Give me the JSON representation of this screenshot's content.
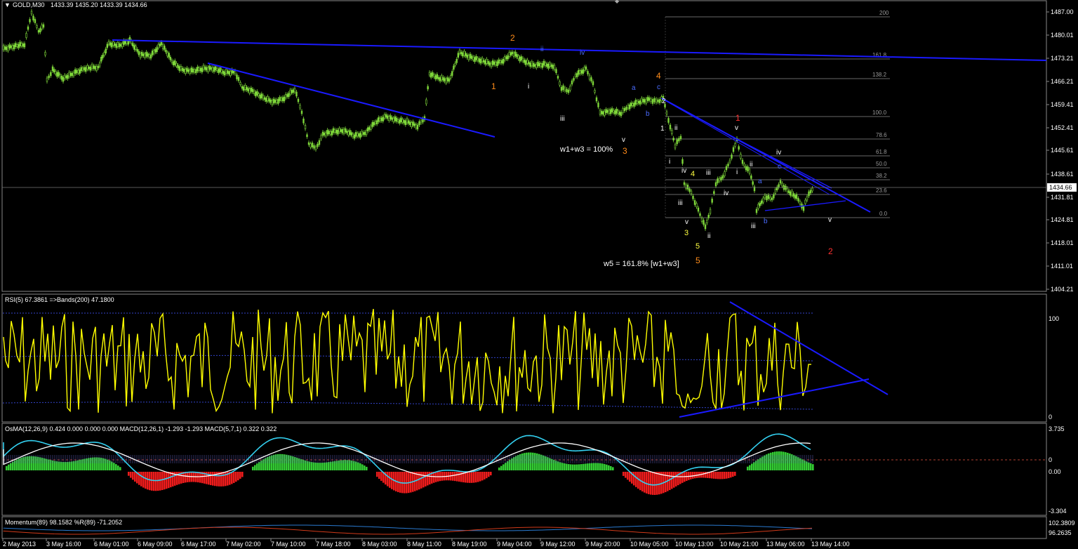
{
  "window": {
    "title": "GOLD,M30",
    "ohlc": "1433.39 1435.20 1433.39 1434.66"
  },
  "main_chart": {
    "price_axis": [
      "1487.00",
      "1480.01",
      "1473.21",
      "1466.21",
      "1459.41",
      "1452.41",
      "1445.61",
      "1438.61",
      "1431.81",
      "1424.81",
      "1418.01",
      "1411.01",
      "1404.21"
    ],
    "current_price": "1434.66",
    "fibs": [
      {
        "label": "200",
        "level": 0
      },
      {
        "label": "161.8",
        "level": 1
      },
      {
        "label": "138.2",
        "level": 2
      },
      {
        "label": "100.0",
        "level": 3
      },
      {
        "label": "78.6",
        "level": 4
      },
      {
        "label": "61.8",
        "level": 5
      },
      {
        "label": "50.0",
        "level": 6
      },
      {
        "label": "38.2",
        "level": 7
      },
      {
        "label": "23.6",
        "level": 8
      },
      {
        "label": "0.0",
        "level": 9
      }
    ],
    "wave_labels": [
      {
        "text": "2",
        "color": "#ff8c1a"
      },
      {
        "text": "1",
        "color": "#ff8c1a"
      },
      {
        "text": "4",
        "color": "#ff8c1a"
      },
      {
        "text": "3",
        "color": "#ff8c1a"
      },
      {
        "text": "5",
        "color": "#ff8c1a"
      },
      {
        "text": "1",
        "color": "#ff3030"
      },
      {
        "text": "2",
        "color": "#ff3030"
      },
      {
        "text": "ii",
        "color": "#4a6cff"
      },
      {
        "text": "iv",
        "color": "#4a6cff"
      },
      {
        "text": "i",
        "color": "#ffffff"
      },
      {
        "text": "iii",
        "color": "#ffffff"
      },
      {
        "text": "v",
        "color": "#ffffff"
      },
      {
        "text": "a",
        "color": "#4a6cff"
      },
      {
        "text": "b",
        "color": "#4a6cff"
      },
      {
        "text": "c",
        "color": "#4a6cff"
      },
      {
        "text": "2",
        "color": "#ffffff"
      },
      {
        "text": "1",
        "color": "#ffffff"
      },
      {
        "text": "ii",
        "color": "#ffffff"
      },
      {
        "text": "i",
        "color": "#ffffff"
      },
      {
        "text": "iv",
        "color": "#ffffff"
      },
      {
        "text": "4",
        "color": "#ffff40"
      },
      {
        "text": "iii",
        "color": "#ffffff"
      },
      {
        "text": "v",
        "color": "#ffffff"
      },
      {
        "text": "3",
        "color": "#ffff40"
      },
      {
        "text": "5",
        "color": "#ffff40"
      },
      {
        "text": "ii",
        "color": "#ffffff"
      },
      {
        "text": "iii",
        "color": "#ffffff"
      },
      {
        "text": "iv",
        "color": "#ffffff"
      },
      {
        "text": "v",
        "color": "#ffffff"
      },
      {
        "text": "i",
        "color": "#ffffff"
      },
      {
        "text": "ii",
        "color": "#ffffff"
      },
      {
        "text": "iv",
        "color": "#ffffff"
      },
      {
        "text": "a",
        "color": "#4a6cff"
      },
      {
        "text": "c",
        "color": "#4a6cff"
      },
      {
        "text": "b",
        "color": "#4a6cff"
      },
      {
        "text": "iii",
        "color": "#ffffff"
      },
      {
        "text": "v",
        "color": "#ffffff"
      }
    ],
    "annotations": {
      "w1w3": "w1+w3 = 100%",
      "w5": "w5 = 161.8% [w1+w3]"
    }
  },
  "rsi": {
    "label": "RSI(5) 67.3861  =>Bands(200) 47.1800",
    "axis_top": "100",
    "axis_bottom": "0"
  },
  "osma": {
    "label": "OsMA(12,26,9) 0.424 0.000 0.000 0.000  MACD(12,26,1) -1.293 -1.293  MACD(5,7,1) 0.322 0.322",
    "axis": [
      "3.735",
      "0",
      "0.00",
      "-3.304"
    ]
  },
  "momentum": {
    "label": "Momentum(89) 98.1582  %R(89) -71.2052",
    "axis": [
      "102.3809",
      "96.2635"
    ]
  },
  "time_axis": [
    "2 May 2013",
    "3 May 16:00",
    "6 May 01:00",
    "6 May 09:00",
    "6 May 17:00",
    "7 May 02:00",
    "7 May 10:00",
    "7 May 18:00",
    "8 May 03:00",
    "8 May 11:00",
    "8 May 19:00",
    "9 May 04:00",
    "9 May 12:00",
    "9 May 20:00",
    "10 May 05:00",
    "10 May 13:00",
    "10 May 21:00",
    "13 May 06:00",
    "13 May 14:00"
  ],
  "colors": {
    "bull_candle": "#7fd83a",
    "trend_line": "#1a1aff",
    "rsi_line": "#ffff00",
    "band": "#3344cc",
    "macd_signal": "#ffffff",
    "macd_fast": "#33d0f0",
    "osma_pos": "#33cc33",
    "osma_neg": "#ee1c1c"
  }
}
